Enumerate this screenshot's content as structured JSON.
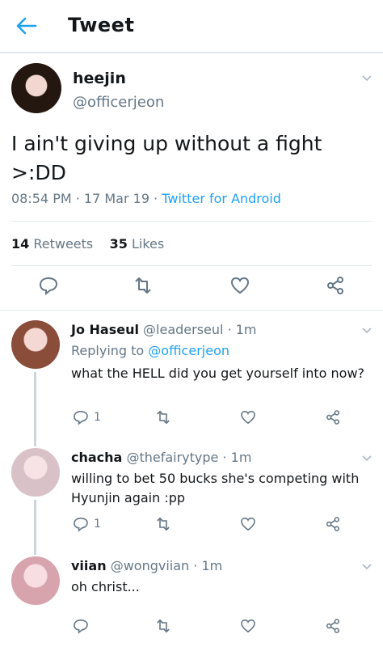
{
  "header": {
    "title": "Tweet",
    "back_icon": "arrow-left-icon"
  },
  "tweet": {
    "display_name": "heejin",
    "handle": "@officerjeon",
    "text": "I ain't giving up without a fight >:DD",
    "time": "08:54 PM",
    "date": "17 Mar 19",
    "source": "Twitter for Android",
    "retweets_count": "14",
    "retweets_label": "Retweets",
    "likes_count": "35",
    "likes_label": "Likes"
  },
  "replies": [
    {
      "display_name": "Jo Haseul",
      "handle": "@leaderseul",
      "time": "1m",
      "replying_prefix": "Replying to",
      "replying_to": "@officerjeon",
      "text": "what the HELL did you get yourself into now?",
      "reply_count": "1"
    },
    {
      "display_name": "chacha",
      "handle": "@thefairytype",
      "time": "1m",
      "text": "willing to bet 50 bucks she's competing with Hyunjin again :pp",
      "reply_count": "1"
    },
    {
      "display_name": "viian",
      "handle": "@wongviian",
      "time": "1m",
      "text": "oh christ..."
    }
  ],
  "colors": {
    "accent": "#1da1f2",
    "muted": "#657786",
    "text": "#14171a",
    "divider": "#e1e8ed"
  }
}
